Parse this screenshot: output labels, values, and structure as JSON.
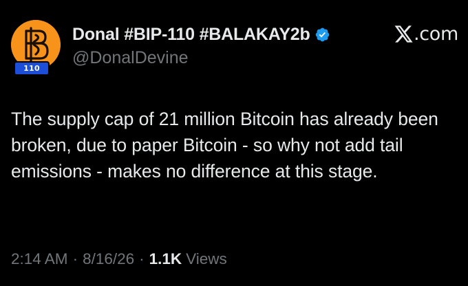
{
  "author": {
    "display_name": "Donal #BIP-110 #BALAKAY2b",
    "handle": "@DonalDevine",
    "verified": true,
    "avatar_badge": "110",
    "avatar_icon": "bitcoin-b-icon"
  },
  "brand": {
    "suffix": ".com",
    "logo_icon": "x-logo-icon"
  },
  "tweet": {
    "text": "The supply cap of 21 million Bitcoin has already been broken, due to paper Bitcoin - so why not add tail emissions - makes no difference at this stage."
  },
  "meta": {
    "time": "2:14 AM",
    "separator": "·",
    "date": "8/16/26",
    "views_count": "1.1K",
    "views_label": "Views"
  },
  "colors": {
    "background": "#000000",
    "primary_text": "#e7e9ea",
    "secondary_text": "#71767b",
    "verified_blue": "#1d9bf0",
    "avatar_orange": "#f7931a",
    "badge_blue": "#1d4ed8"
  }
}
